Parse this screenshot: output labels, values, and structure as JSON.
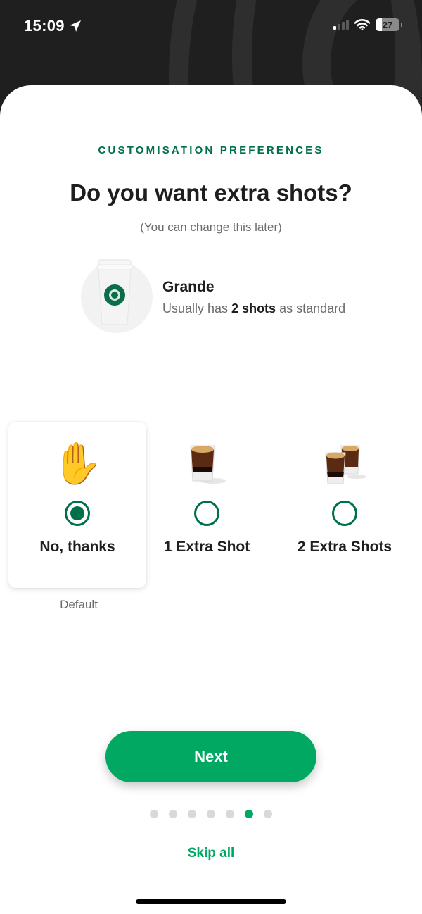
{
  "status_bar": {
    "time": "15:09",
    "location_icon": "location-arrow-icon",
    "signal_icon": "cellular-signal-icon",
    "wifi_icon": "wifi-icon",
    "battery_level": "27"
  },
  "header": {
    "eyebrow": "CUSTOMISATION PREFERENCES",
    "title": "Do you want extra shots?",
    "subtitle": "(You can change this later)"
  },
  "size": {
    "name": "Grande",
    "desc_prefix": "Usually has ",
    "desc_bold": "2 shots",
    "desc_suffix": " as standard",
    "image": "starbucks-cup-icon"
  },
  "options": [
    {
      "label": "No, thanks",
      "icon": "raised-hand-icon",
      "glyph": "✋",
      "selected": true
    },
    {
      "label": "1 Extra Shot",
      "icon": "espresso-shot-icon",
      "selected": false
    },
    {
      "label": "2 Extra Shots",
      "icon": "two-espresso-shots-icon",
      "selected": false
    }
  ],
  "default_note": "Default",
  "next_button": "Next",
  "pager": {
    "total": 7,
    "current": 6
  },
  "skip_all": "Skip all",
  "colors": {
    "brand_green": "#00704a",
    "accent_green": "#00a862",
    "text_dark": "#1e1e1e",
    "text_muted": "#6b6b6b"
  }
}
